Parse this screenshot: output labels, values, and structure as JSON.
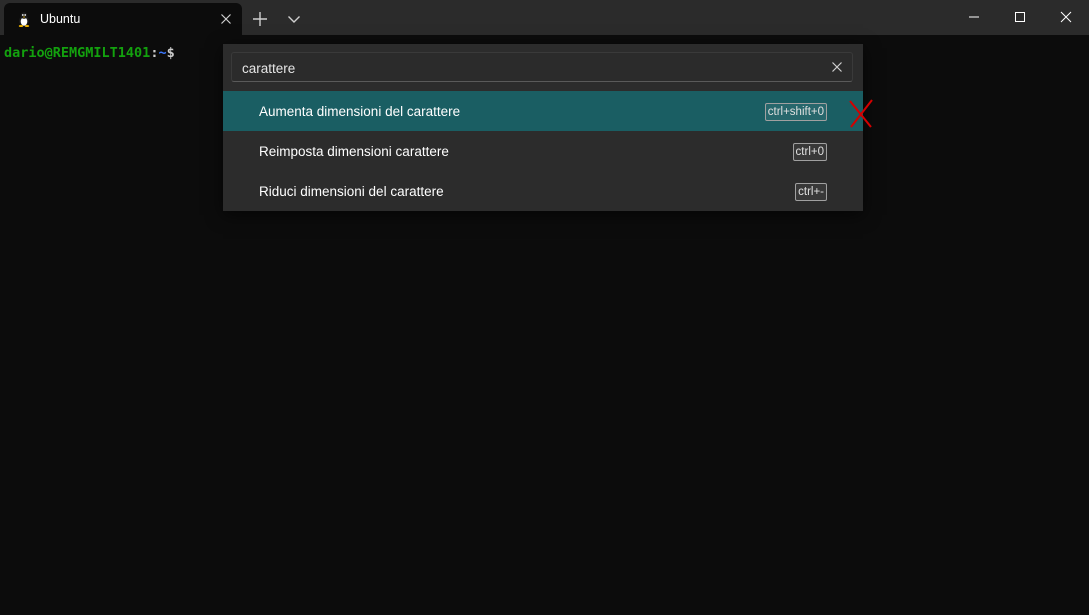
{
  "tabs": [
    {
      "title": "Ubuntu",
      "icon": "linux-tux-icon",
      "active": true
    }
  ],
  "titlebar": {
    "new_tab_icon": "plus-icon",
    "dropdown_icon": "chevron-down-icon",
    "minimize_icon": "minimize-icon",
    "maximize_icon": "maximize-icon",
    "close_icon": "close-icon"
  },
  "terminal": {
    "prompt_user_host": "dario@REMGMILT1401",
    "prompt_colon": ":",
    "prompt_path": "~",
    "prompt_symbol": "$"
  },
  "command_palette": {
    "search_value": "carattere",
    "commands": [
      {
        "label": "Aumenta dimensioni del carattere",
        "keybinding": "ctrl+shift+0",
        "selected": true
      },
      {
        "label": "Reimposta dimensioni carattere",
        "keybinding": "ctrl+0",
        "selected": false
      },
      {
        "label": "Riduci dimensioni del carattere",
        "keybinding": "ctrl+-",
        "selected": false
      }
    ]
  },
  "colors": {
    "background": "#0c0c0c",
    "titlebar": "#2b2b2b",
    "palette_bg": "#2c2c2c",
    "selected_row": "#1a5e63",
    "prompt_green": "#13a10e",
    "prompt_blue": "#3b78ff",
    "annotation_red": "#d40000"
  }
}
